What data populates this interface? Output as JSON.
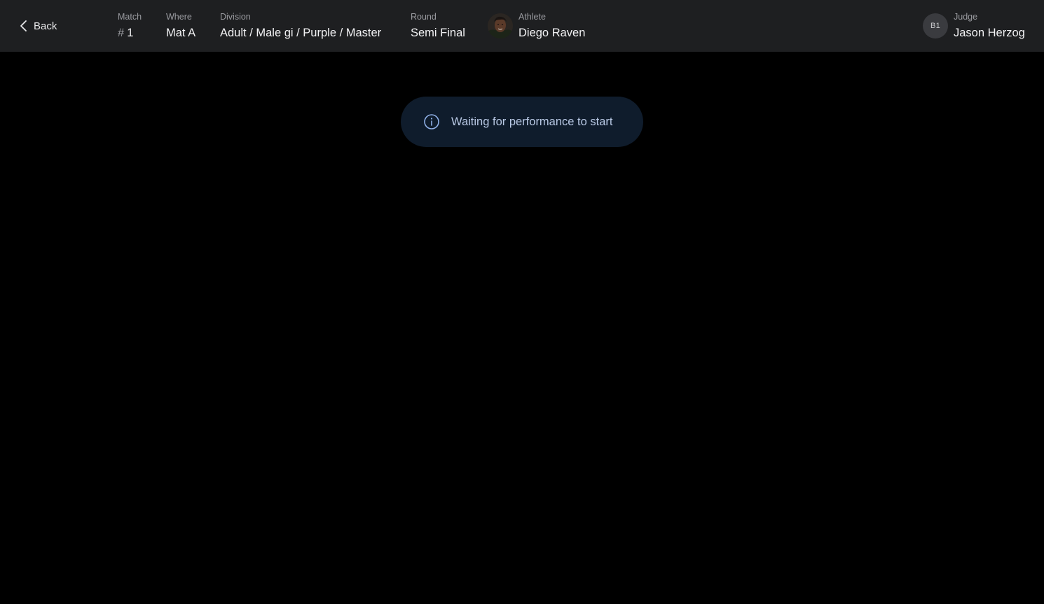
{
  "header": {
    "back_label": "Back",
    "match": {
      "label": "Match",
      "prefix": "#",
      "value": "1"
    },
    "where": {
      "label": "Where",
      "value": "Mat A"
    },
    "division": {
      "label": "Division",
      "value": "Adult / Male gi / Purple / Master"
    },
    "round": {
      "label": "Round",
      "value": "Semi Final"
    },
    "athlete": {
      "label": "Athlete",
      "name": "Diego Raven"
    },
    "judge": {
      "label": "Judge",
      "initials": "B1",
      "name": "Jason Herzog"
    }
  },
  "status": {
    "message": "Waiting for performance to start",
    "icon": "info-icon"
  },
  "colors": {
    "background": "#000000",
    "header_bg": "#1e1f21",
    "banner_bg": "#0f1c2c",
    "banner_text": "#b8c8e4"
  }
}
